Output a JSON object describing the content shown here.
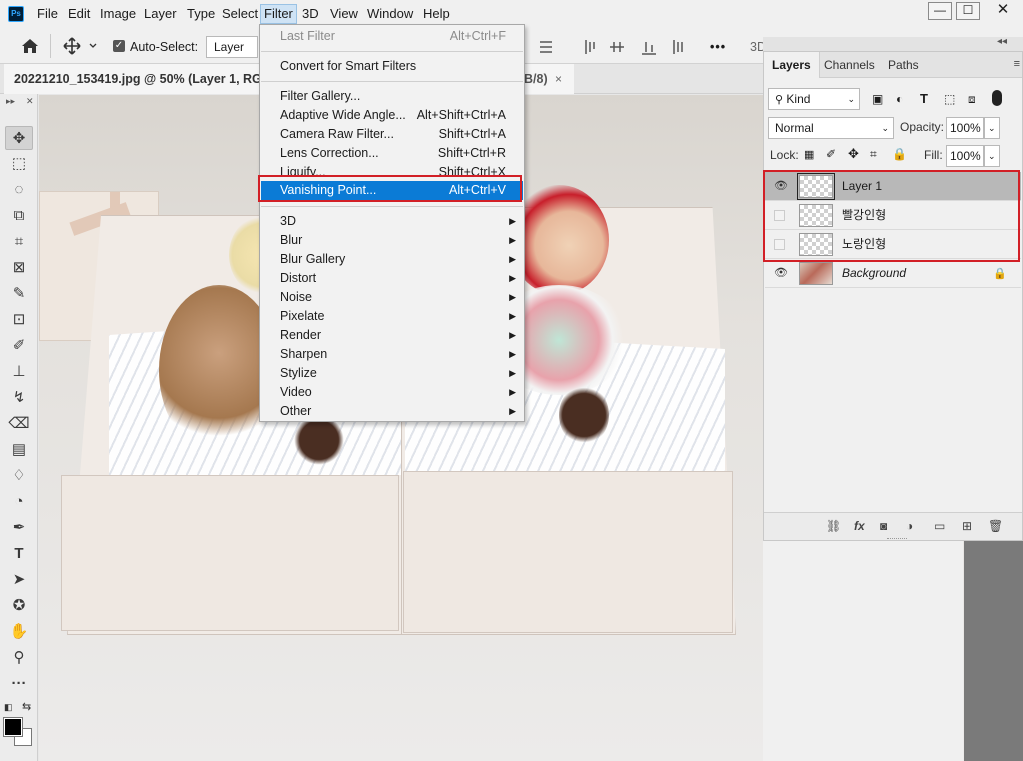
{
  "menubar": {
    "logo": "Ps",
    "items": [
      "File",
      "Edit",
      "Image",
      "Layer",
      "Type",
      "Select",
      "Filter",
      "3D",
      "View",
      "Window",
      "Help"
    ],
    "active": "Filter",
    "window_controls": [
      "—",
      "☐",
      "✕"
    ]
  },
  "options": {
    "auto_select_label": "Auto-Select:",
    "auto_select_value": "Layer",
    "more": "•••",
    "mode_3d": "3D"
  },
  "document": {
    "tab_title": "20221210_153419.jpg @ 50% (Layer 1, RGB",
    "tab_suffix": "B/8)",
    "close": "×"
  },
  "filter_menu": {
    "last_filter": {
      "label": "Last Filter",
      "shortcut": "Alt+Ctrl+F"
    },
    "convert": {
      "label": "Convert for Smart Filters"
    },
    "gallery": {
      "label": "Filter Gallery..."
    },
    "adaptive": {
      "label": "Adaptive Wide Angle...",
      "shortcut": "Alt+Shift+Ctrl+A"
    },
    "camera_raw": {
      "label": "Camera Raw Filter...",
      "shortcut": "Shift+Ctrl+A"
    },
    "lens": {
      "label": "Lens Correction...",
      "shortcut": "Shift+Ctrl+R"
    },
    "liquify": {
      "label": "Liquify...",
      "shortcut": "Shift+Ctrl+X"
    },
    "vanishing": {
      "label": "Vanishing Point...",
      "shortcut": "Alt+Ctrl+V"
    },
    "submenus": [
      "3D",
      "Blur",
      "Blur Gallery",
      "Distort",
      "Noise",
      "Pixelate",
      "Render",
      "Sharpen",
      "Stylize",
      "Video",
      "Other"
    ]
  },
  "layers_panel": {
    "tabs": [
      "Layers",
      "Channels",
      "Paths"
    ],
    "active_tab": "Layers",
    "kind_label": "Kind",
    "blend_mode": "Normal",
    "opacity_label": "Opacity:",
    "opacity_value": "100%",
    "lock_label": "Lock:",
    "fill_label": "Fill:",
    "fill_value": "100%",
    "layers": [
      {
        "name": "Layer 1",
        "visible": true,
        "selected": true
      },
      {
        "name": "빨강인형",
        "visible": false,
        "selected": false
      },
      {
        "name": "노랑인형",
        "visible": false,
        "selected": false
      },
      {
        "name": "Background",
        "visible": true,
        "selected": false,
        "locked": true
      }
    ],
    "footer_icons": [
      "link-icon",
      "fx-icon",
      "mask-icon",
      "adjustment-icon",
      "folder-icon",
      "new-layer-icon",
      "trash-icon"
    ]
  },
  "tools": [
    "move-tool",
    "marquee-tool",
    "lasso-tool",
    "object-select-tool",
    "crop-tool",
    "frame-tool",
    "eyedropper-tool",
    "healing-tool",
    "brush-tool",
    "stamp-tool",
    "history-brush-tool",
    "eraser-tool",
    "gradient-tool",
    "blur-tool",
    "dodge-tool",
    "pen-tool",
    "type-tool",
    "path-select-tool",
    "shape-tool",
    "hand-tool",
    "zoom-tool",
    "more-tools"
  ],
  "colors": {
    "highlight": "#0b7bd6",
    "annotation_red": "#d21f26",
    "ps_blue": "#31a8ff"
  }
}
